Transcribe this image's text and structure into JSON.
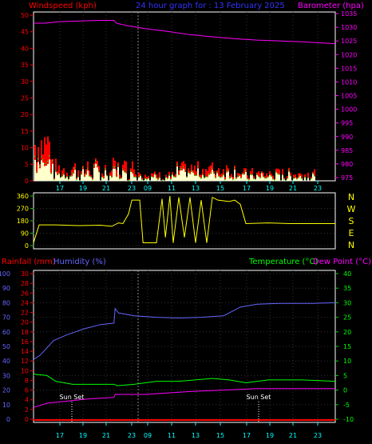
{
  "header": {
    "left": "Windspeed (kph)",
    "center": "24 hour graph for : 13 February 2025",
    "right": "Barometer (hpa)"
  },
  "lower_header": {
    "rainfall": "Rainfall (mm)",
    "humidity": "Humidity (%)",
    "temperature": "Temperature (°C)",
    "dewpoint": "Dew Point (°C)"
  },
  "colors": {
    "wind": "#ff0000",
    "gust": "#00ff00",
    "wind_light": "#ffffcc",
    "baro": "#ff00ff",
    "dir": "#ffff00",
    "humidity": "#6666ff",
    "temperature": "#00ff00",
    "dewpoint": "#ff00ff",
    "rain": "#ff0000",
    "axis_green": "#00cc00",
    "axis_cyan": "#00ffff"
  },
  "sunset_label": "Sun Set",
  "compass": [
    "N",
    "W",
    "S",
    "E",
    "N"
  ],
  "chart_data": [
    {
      "type": "area",
      "name": "wind",
      "x_tick_labels": [
        "17",
        "19",
        "21",
        "23",
        "09",
        "11",
        "13",
        "15",
        "17",
        "19",
        "21",
        "23"
      ],
      "left_ylim": [
        0,
        50
      ],
      "left_ticks": [
        "0",
        "5",
        "10",
        "15",
        "20",
        "25",
        "30",
        "35",
        "40",
        "45",
        "50"
      ],
      "right_ylim": [
        975,
        1035
      ],
      "right_ticks": [
        "975",
        "980",
        "985",
        "990",
        "995",
        "1000",
        "1005",
        "1010",
        "1015",
        "1020",
        "1025",
        "1030",
        "1035"
      ],
      "barometer": [
        [
          0,
          1031.5
        ],
        [
          10,
          1031.5
        ],
        [
          22,
          1032.0
        ],
        [
          40,
          1032.3
        ],
        [
          60,
          1032.5
        ],
        [
          72,
          1032.5
        ],
        [
          74,
          1031.5
        ],
        [
          85,
          1030.5
        ],
        [
          100,
          1029.5
        ],
        [
          120,
          1028.5
        ],
        [
          140,
          1027.3
        ],
        [
          160,
          1026.5
        ],
        [
          180,
          1025.8
        ],
        [
          200,
          1025.3
        ],
        [
          220,
          1025.0
        ],
        [
          240,
          1024.7
        ],
        [
          260,
          1024.2
        ],
        [
          270,
          1024.0
        ]
      ],
      "wind_speed_peak": 18,
      "wind_speed_typical": 3,
      "gust_peak": 8
    },
    {
      "type": "line",
      "name": "wind_direction",
      "ylim": [
        0,
        360
      ],
      "ticks": [
        "0",
        "90",
        "180",
        "270",
        "360"
      ],
      "series": [
        [
          0,
          20
        ],
        [
          5,
          150
        ],
        [
          20,
          150
        ],
        [
          40,
          145
        ],
        [
          60,
          148
        ],
        [
          70,
          140
        ],
        [
          76,
          165
        ],
        [
          80,
          160
        ],
        [
          85,
          230
        ],
        [
          88,
          330
        ],
        [
          95,
          330
        ],
        [
          98,
          20
        ],
        [
          110,
          20
        ],
        [
          115,
          340
        ],
        [
          118,
          60
        ],
        [
          122,
          360
        ],
        [
          125,
          20
        ],
        [
          130,
          350
        ],
        [
          135,
          60
        ],
        [
          140,
          350
        ],
        [
          145,
          20
        ],
        [
          150,
          330
        ],
        [
          155,
          20
        ],
        [
          160,
          350
        ],
        [
          165,
          330
        ],
        [
          175,
          320
        ],
        [
          180,
          330
        ],
        [
          185,
          300
        ],
        [
          190,
          160
        ],
        [
          210,
          165
        ],
        [
          230,
          160
        ],
        [
          270,
          160
        ]
      ]
    },
    {
      "type": "line",
      "name": "temp_humidity",
      "humidity_ylim": [
        0,
        100
      ],
      "humidity_ticks": [
        "0",
        "10",
        "20",
        "30",
        "40",
        "50",
        "60",
        "70",
        "80",
        "90",
        "100"
      ],
      "rain_ylim": [
        0,
        30
      ],
      "rain_ticks": [
        "0",
        "2",
        "4",
        "6",
        "8",
        "10",
        "12",
        "14",
        "16",
        "18",
        "20",
        "22",
        "24",
        "26",
        "28",
        "30"
      ],
      "temp_ylim": [
        -10,
        40
      ],
      "temp_ticks": [
        "-10",
        "-5",
        "0",
        "5",
        "10",
        "15",
        "20",
        "25",
        "30",
        "35",
        "40"
      ],
      "humidity": [
        [
          0,
          41
        ],
        [
          6,
          44
        ],
        [
          18,
          54
        ],
        [
          30,
          58
        ],
        [
          45,
          62
        ],
        [
          60,
          65
        ],
        [
          72,
          66
        ],
        [
          73,
          76
        ],
        [
          76,
          73
        ],
        [
          90,
          71
        ],
        [
          110,
          70
        ],
        [
          130,
          69.5
        ],
        [
          150,
          70
        ],
        [
          170,
          71
        ],
        [
          175,
          73
        ],
        [
          185,
          77
        ],
        [
          200,
          79
        ],
        [
          220,
          79.5
        ],
        [
          250,
          79.5
        ],
        [
          270,
          80
        ]
      ],
      "temperature": [
        [
          0,
          5.5
        ],
        [
          12,
          5
        ],
        [
          20,
          3
        ],
        [
          35,
          2
        ],
        [
          50,
          2
        ],
        [
          72,
          2
        ],
        [
          75,
          1.5
        ],
        [
          90,
          2
        ],
        [
          110,
          3
        ],
        [
          130,
          3
        ],
        [
          160,
          4
        ],
        [
          175,
          3.5
        ],
        [
          190,
          2.5
        ],
        [
          210,
          3.5
        ],
        [
          240,
          3.5
        ],
        [
          270,
          3
        ]
      ],
      "dewpoint": [
        [
          0,
          -6
        ],
        [
          12,
          -4.5
        ],
        [
          25,
          -4
        ],
        [
          50,
          -3
        ],
        [
          72,
          -2.5
        ],
        [
          73,
          -1.5
        ],
        [
          100,
          -1.5
        ],
        [
          140,
          -0.5
        ],
        [
          170,
          0
        ],
        [
          200,
          0.5
        ],
        [
          240,
          0.5
        ],
        [
          270,
          0.5
        ]
      ],
      "rainfall": [
        [
          0,
          0
        ],
        [
          270,
          0
        ]
      ]
    }
  ]
}
